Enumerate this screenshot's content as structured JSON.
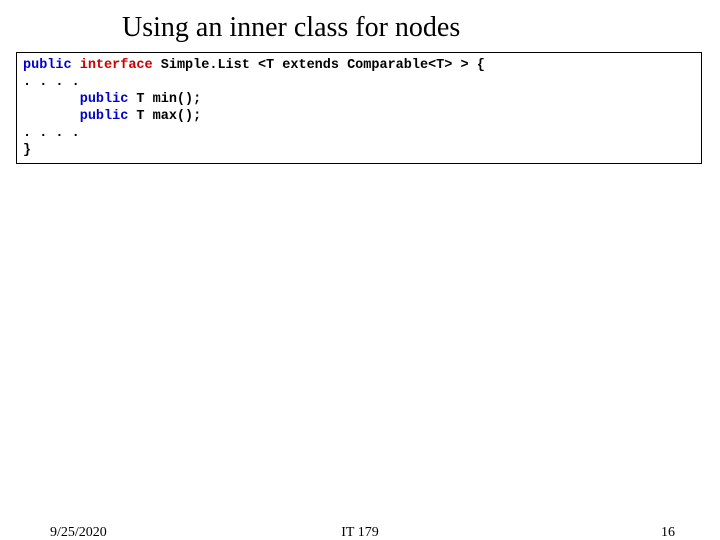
{
  "title": "Using an inner class for nodes",
  "code": {
    "kw_public": "public",
    "kw_interface": "interface",
    "l1_rest": " Simple.List <T extends Comparable<T> > {",
    "l2": ". . . .",
    "l3_rest": " T min();",
    "l4_rest": " T max();",
    "l5": ". . . .",
    "l6": "}"
  },
  "footer": {
    "date": "9/25/2020",
    "course": "IT 179",
    "page": "16"
  }
}
